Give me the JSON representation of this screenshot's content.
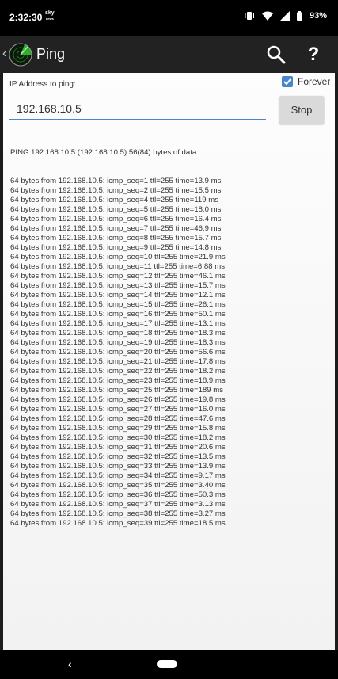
{
  "status_bar": {
    "time": "2:32:30",
    "sky_top": "sky",
    "sky_bottom": "news",
    "battery": "93%"
  },
  "action_bar": {
    "title": "Ping"
  },
  "form": {
    "ip_label": "IP Address to ping:",
    "forever_label": "Forever",
    "forever_checked": true,
    "ip_value": "192.168.10.5",
    "stop_label": "Stop"
  },
  "output": {
    "header": "PING 192.168.10.5 (192.168.10.5) 56(84) bytes of data.",
    "lines": [
      "64 bytes from 192.168.10.5: icmp_seq=1 ttl=255 time=13.9 ms",
      "64 bytes from 192.168.10.5: icmp_seq=2 ttl=255 time=15.5 ms",
      "64 bytes from 192.168.10.5: icmp_seq=4 ttl=255 time=119 ms",
      "64 bytes from 192.168.10.5: icmp_seq=5 ttl=255 time=18.0 ms",
      "64 bytes from 192.168.10.5: icmp_seq=6 ttl=255 time=16.4 ms",
      "64 bytes from 192.168.10.5: icmp_seq=7 ttl=255 time=46.9 ms",
      "64 bytes from 192.168.10.5: icmp_seq=8 ttl=255 time=15.7 ms",
      "64 bytes from 192.168.10.5: icmp_seq=9 ttl=255 time=14.8 ms",
      "64 bytes from 192.168.10.5: icmp_seq=10 ttl=255 time=21.9 ms",
      "64 bytes from 192.168.10.5: icmp_seq=11 ttl=255 time=6.88 ms",
      "64 bytes from 192.168.10.5: icmp_seq=12 ttl=255 time=46.1 ms",
      "64 bytes from 192.168.10.5: icmp_seq=13 ttl=255 time=15.7 ms",
      "64 bytes from 192.168.10.5: icmp_seq=14 ttl=255 time=12.1 ms",
      "64 bytes from 192.168.10.5: icmp_seq=15 ttl=255 time=26.1 ms",
      "64 bytes from 192.168.10.5: icmp_seq=16 ttl=255 time=50.1 ms",
      "64 bytes from 192.168.10.5: icmp_seq=17 ttl=255 time=13.1 ms",
      "64 bytes from 192.168.10.5: icmp_seq=18 ttl=255 time=18.3 ms",
      "64 bytes from 192.168.10.5: icmp_seq=19 ttl=255 time=18.3 ms",
      "64 bytes from 192.168.10.5: icmp_seq=20 ttl=255 time=56.6 ms",
      "64 bytes from 192.168.10.5: icmp_seq=21 ttl=255 time=17.8 ms",
      "64 bytes from 192.168.10.5: icmp_seq=22 ttl=255 time=18.2 ms",
      "64 bytes from 192.168.10.5: icmp_seq=23 ttl=255 time=18.9 ms",
      "64 bytes from 192.168.10.5: icmp_seq=25 ttl=255 time=189 ms",
      "64 bytes from 192.168.10.5: icmp_seq=26 ttl=255 time=19.8 ms",
      "64 bytes from 192.168.10.5: icmp_seq=27 ttl=255 time=16.0 ms",
      "64 bytes from 192.168.10.5: icmp_seq=28 ttl=255 time=47.6 ms",
      "64 bytes from 192.168.10.5: icmp_seq=29 ttl=255 time=15.8 ms",
      "64 bytes from 192.168.10.5: icmp_seq=30 ttl=255 time=18.2 ms",
      "64 bytes from 192.168.10.5: icmp_seq=31 ttl=255 time=20.6 ms",
      "64 bytes from 192.168.10.5: icmp_seq=32 ttl=255 time=13.5 ms",
      "64 bytes from 192.168.10.5: icmp_seq=33 ttl=255 time=13.9 ms",
      "64 bytes from 192.168.10.5: icmp_seq=34 ttl=255 time=9.17 ms",
      "64 bytes from 192.168.10.5: icmp_seq=35 ttl=255 time=3.40 ms",
      "64 bytes from 192.168.10.5: icmp_seq=36 ttl=255 time=50.3 ms",
      "64 bytes from 192.168.10.5: icmp_seq=37 ttl=255 time=3.13 ms",
      "64 bytes from 192.168.10.5: icmp_seq=38 ttl=255 time=3.27 ms",
      "64 bytes from 192.168.10.5: icmp_seq=39 ttl=255 time=18.5 ms"
    ]
  },
  "icons": {
    "vibrate": "vibrate-icon",
    "wifi": "wifi-icon",
    "signal": "cell-signal-icon",
    "battery": "battery-icon",
    "search": "search-icon",
    "help": "help-icon",
    "app_logo": "radar-icon"
  },
  "colors": {
    "accent": "#4a87c8",
    "action_bar": "#222222",
    "status_bar": "#000000"
  }
}
